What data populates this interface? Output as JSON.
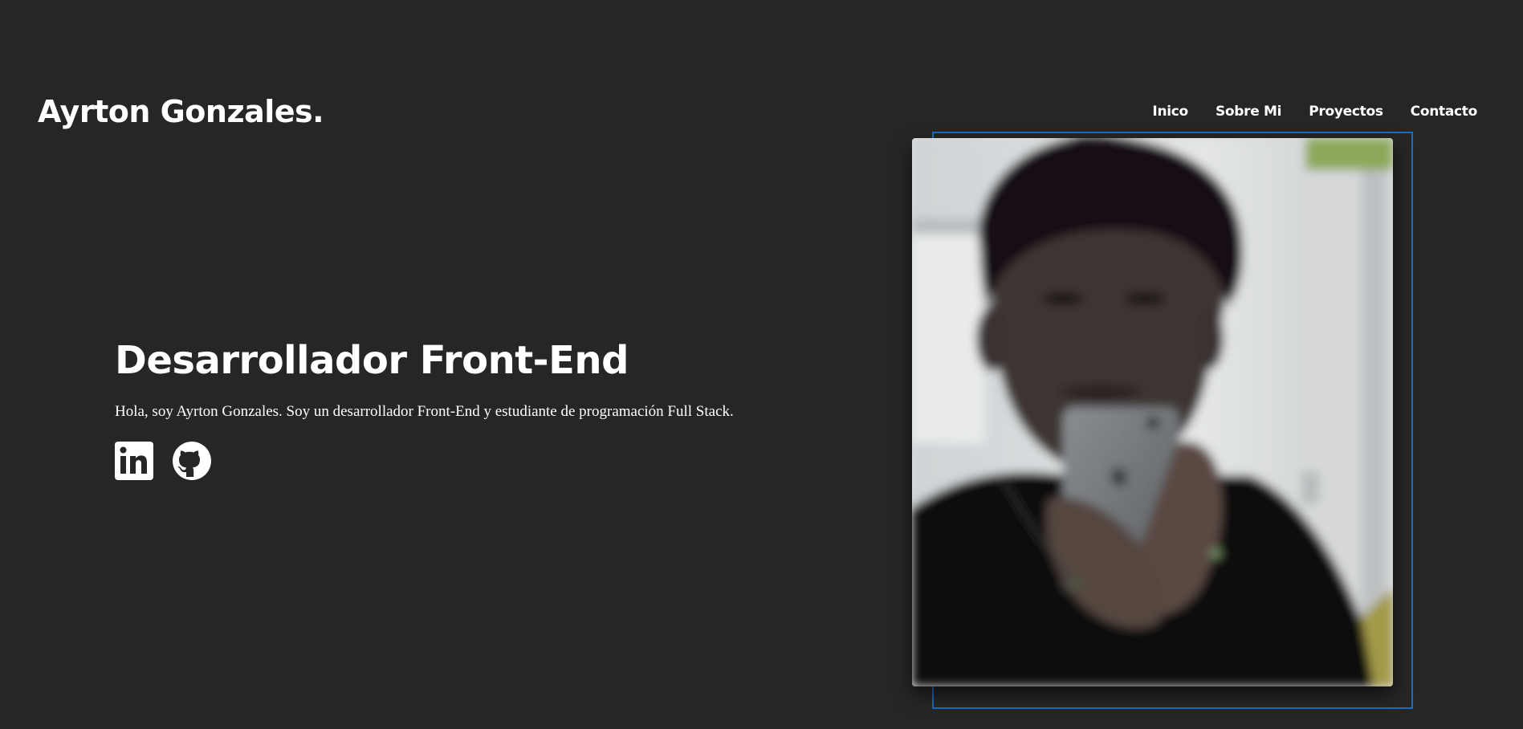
{
  "header": {
    "brand": "Ayrton Gonzales.",
    "nav": [
      {
        "label": "Inico"
      },
      {
        "label": "Sobre Mi"
      },
      {
        "label": "Proyectos"
      },
      {
        "label": "Contacto"
      }
    ]
  },
  "hero": {
    "title": "Desarrollador Front-End",
    "text": "Hola, soy Ayrton Gonzales. Soy un desarrollador Front-End y estudiante de programación Full Stack.",
    "social": [
      {
        "icon": "linkedin-icon"
      },
      {
        "icon": "github-icon"
      }
    ]
  },
  "colors": {
    "background": "#262626",
    "text": "#ffffff",
    "frame_accent": "#1a6fc4"
  }
}
